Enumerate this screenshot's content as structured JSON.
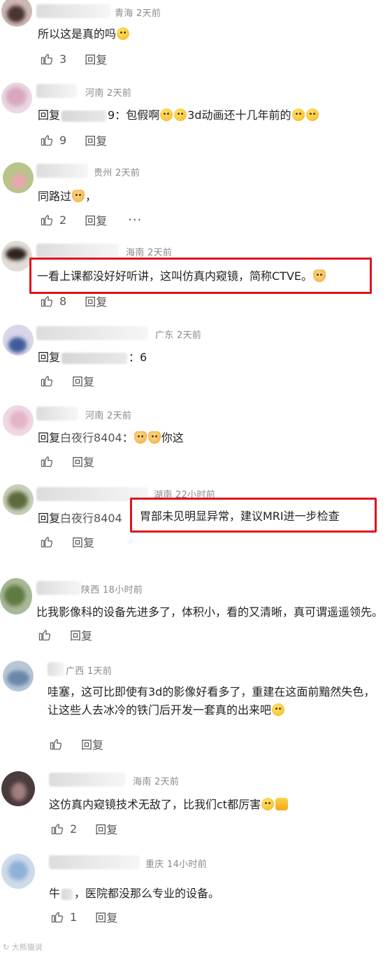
{
  "comments": [
    {
      "region": "青海 2天前",
      "text": "所以这是真的吗",
      "emojis": [
        "grin"
      ],
      "likes": "3",
      "reply": "回复"
    },
    {
      "region": "河南 2天前",
      "prefix": "回复",
      "suffix": "9：包假啊",
      "text_after": "3d动画还十几年前的",
      "likes": "9",
      "reply": "回复"
    },
    {
      "region": "贵州 2天前",
      "text": "同路过",
      "tail": "，",
      "likes": "2",
      "reply": "回复",
      "more": "···"
    },
    {
      "region": "海南 2天前",
      "text": "一看上课都没好好听讲，这叫仿真内窥镜，简称CTVE。",
      "likes": "8",
      "reply": "回复"
    },
    {
      "region": "广东 2天前",
      "prefix": "回复",
      "suffix": "：6",
      "reply": "回复"
    },
    {
      "region": "河南 2天前",
      "prefix": "回复",
      "mention": "白夜行8404",
      "colon": "：",
      "text_after": "你这",
      "reply": "回复"
    },
    {
      "region": "湖南 22小时前",
      "prefix": "回复",
      "mention": "白夜行8404",
      "highlight_text": "胃部未见明显异常，建议MRI进一步检查",
      "reply": "回复"
    },
    {
      "region": "陕西 18小时前",
      "text": "比我影像科的设备先进多了，体积小，看的又清晰，真可谓遥遥领先。",
      "reply": "回复"
    },
    {
      "region": "广西 1天前",
      "text": "哇塞，这可比即使有3d的影像好看多了，重建在这面前黯然失色，让这些人去冰冷的铁门后开发一套真的出来吧",
      "reply": "回复"
    },
    {
      "region": "海南 2天前",
      "text": "这仿真内窥镜技术无敌了，比我们ct都厉害",
      "likes": "2",
      "reply": "回复"
    },
    {
      "region": "重庆 14小时前",
      "text_a": "牛",
      "text_b": "，医院都没那么专业的设备。",
      "likes": "1",
      "reply": "回复"
    }
  ],
  "watermark": "大熊猫说",
  "colors": {
    "highlight_border": "#e0131c",
    "meta_gray": "#8a8a8a",
    "text": "#222222"
  },
  "icons": [
    "thumbs-up-icon",
    "grin-emoji",
    "cat-emoji",
    "laugh-emoji",
    "thumbs-emoji"
  ]
}
